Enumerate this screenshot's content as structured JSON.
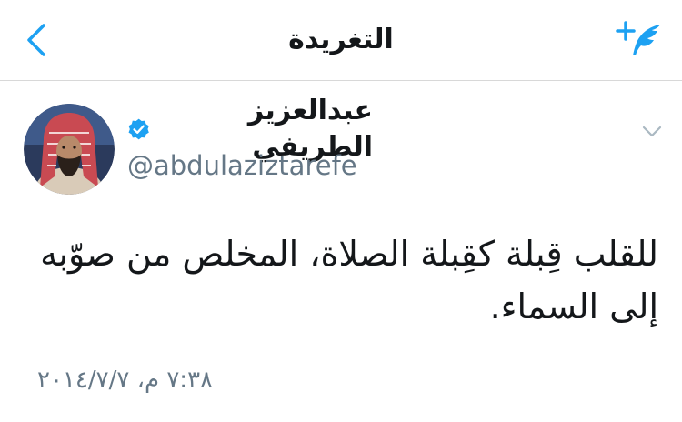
{
  "navbar": {
    "title": "التغريدة",
    "back_icon": "chevron-left-icon",
    "compose_icon": "compose-tweet-icon"
  },
  "tweet": {
    "author": {
      "display_name": "عبدالعزيز الطريفي",
      "handle": "@abdulaziztarefe",
      "verified": true
    },
    "text": "للقلب قِبلة كقِبلة الصلاة، المخلص من صوّبه إلى السماء.",
    "timestamp": "٧:٣٨ م، ٢٠١٤/٧/٧"
  },
  "colors": {
    "accent": "#1da1f2",
    "text_primary": "#14171a",
    "text_secondary": "#657786",
    "divider": "#d8d8d8"
  }
}
